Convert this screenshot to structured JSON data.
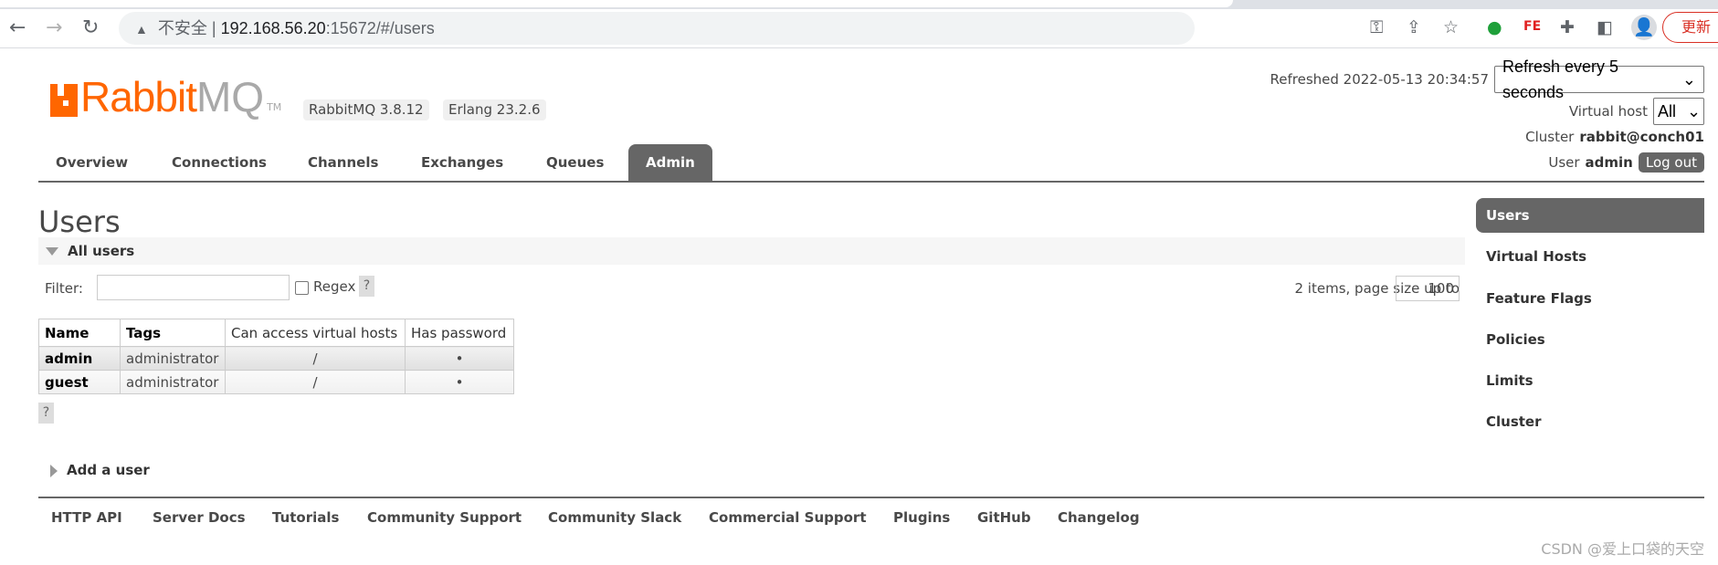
{
  "browser": {
    "url_warning": "不安全",
    "url_host": "192.168.56.20",
    "url_rest": ":15672/#/users",
    "update_label": "更新"
  },
  "header": {
    "logo_text_1": "Rabbit",
    "logo_text_2": "MQ",
    "logo_tm": "TM",
    "version_badge": "RabbitMQ 3.8.12",
    "erlang_badge": "Erlang 23.2.6",
    "refreshed_label": "Refreshed 2022-05-13 20:34:57",
    "refresh_select": "Refresh every 5 seconds",
    "vhost_label": "Virtual host",
    "vhost_select": "All",
    "cluster_label": "Cluster",
    "cluster_name": "rabbit@conch01",
    "user_label": "User",
    "user_name": "admin",
    "logout_label": "Log out"
  },
  "nav": {
    "tabs": [
      "Overview",
      "Connections",
      "Channels",
      "Exchanges",
      "Queues",
      "Admin"
    ],
    "active": "Admin"
  },
  "main": {
    "title": "Users",
    "section_title": "All users",
    "filter_label": "Filter:",
    "filter_value": "",
    "regex_label": "Regex",
    "help_label": "?",
    "pager_text": "2 items, page size up to",
    "page_size": "100",
    "table": {
      "headers": [
        "Name",
        "Tags",
        "Can access virtual hosts",
        "Has password"
      ],
      "rows": [
        {
          "name": "admin",
          "tags": "administrator",
          "vhosts": "/",
          "has_password": "•"
        },
        {
          "name": "guest",
          "tags": "administrator",
          "vhosts": "/",
          "has_password": "•"
        }
      ]
    },
    "add_user": "Add a user"
  },
  "sidebar": {
    "items": [
      "Users",
      "Virtual Hosts",
      "Feature Flags",
      "Policies",
      "Limits",
      "Cluster"
    ],
    "active": "Users"
  },
  "footer": {
    "links": [
      "HTTP API",
      "Server Docs",
      "Tutorials",
      "Community Support",
      "Community Slack",
      "Commercial Support",
      "Plugins",
      "GitHub",
      "Changelog"
    ]
  },
  "watermark": "CSDN @爱上口袋的天空",
  "colors": {
    "brand": "#ff6600",
    "active_tab": "#666666"
  }
}
